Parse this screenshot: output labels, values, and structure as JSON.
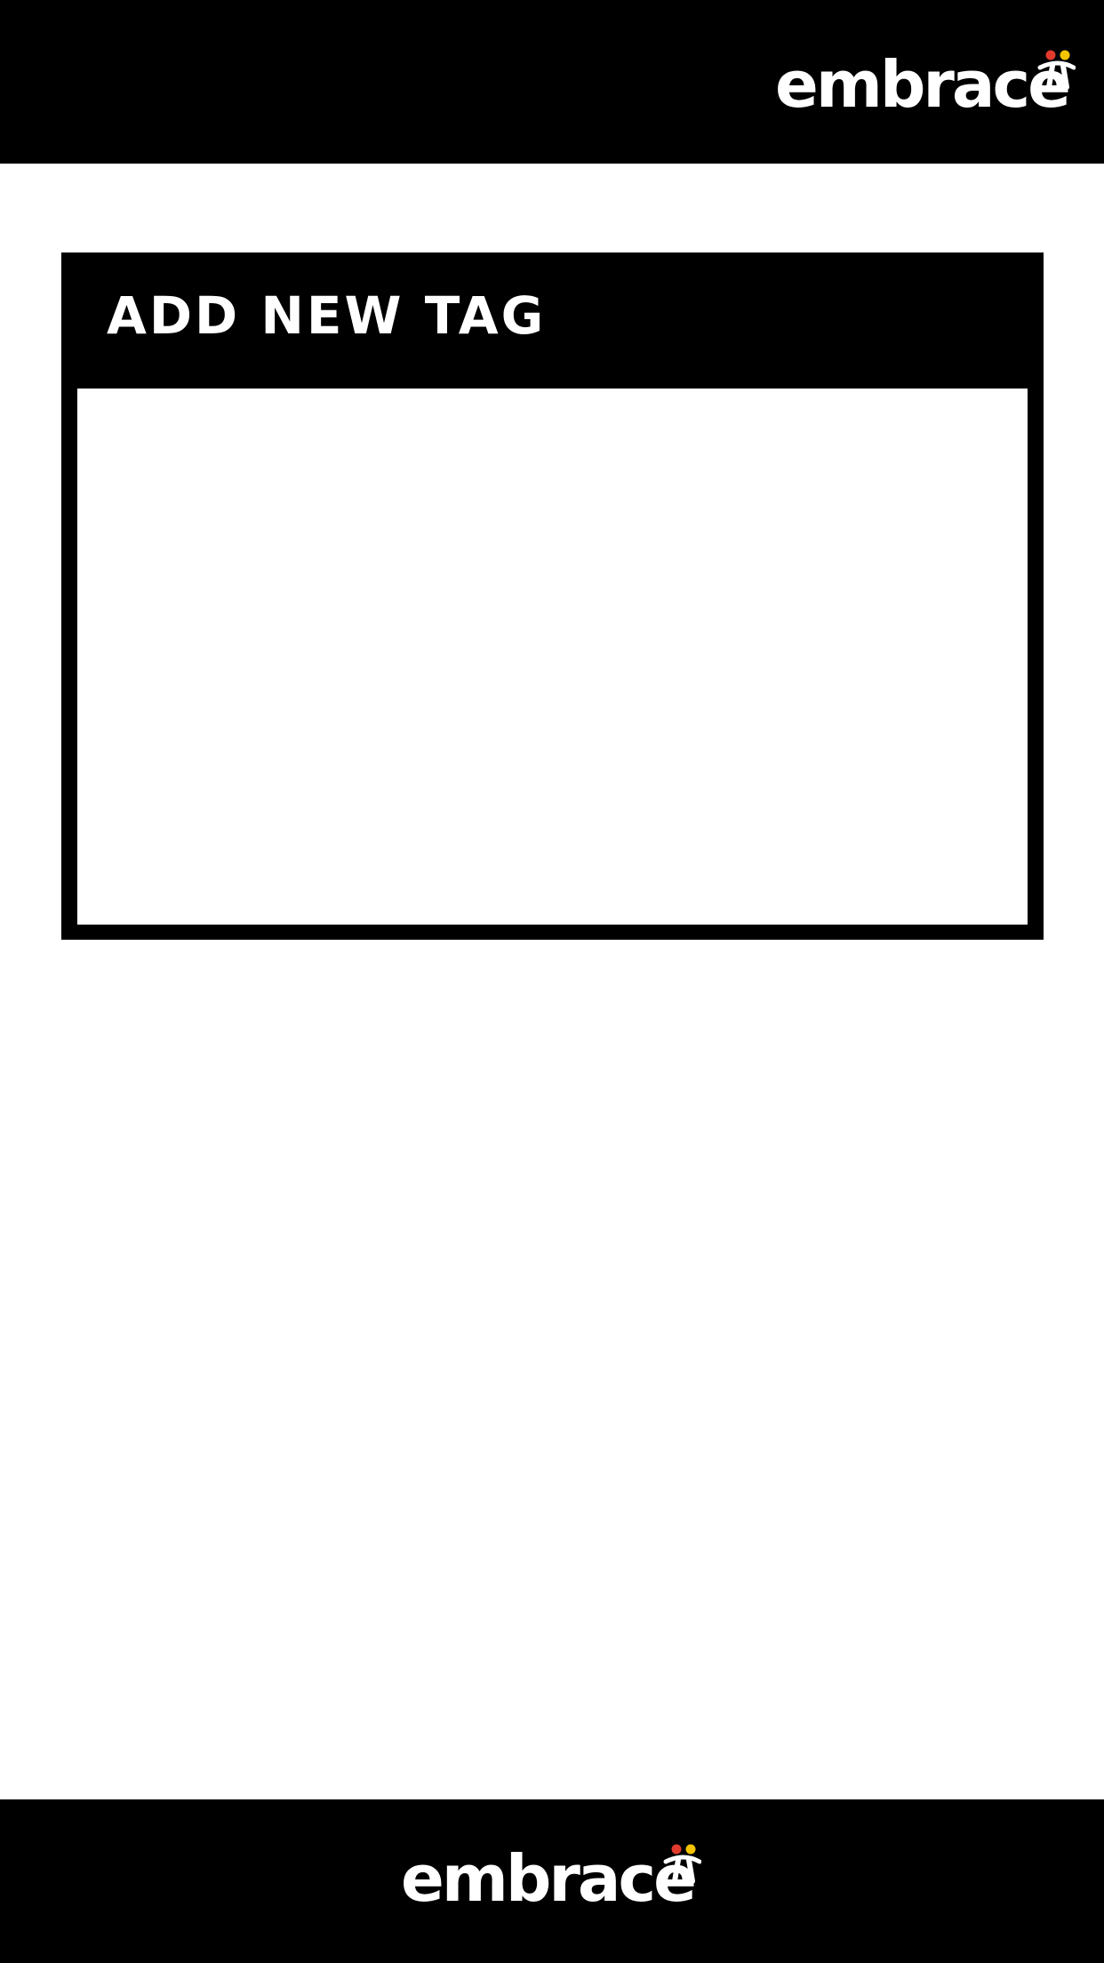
{
  "header": {
    "logo_text": "embrace",
    "logo_icon": "embrace-people-icon"
  },
  "dialog": {
    "title": "ADD NEW TAG"
  },
  "footer": {
    "logo_text": "embrace",
    "logo_icon": "embrace-people-icon"
  },
  "colors": {
    "bar": "#000000",
    "background": "#ffffff",
    "logo_text": "#ffffff",
    "figure_left_head": "#e23b2e",
    "figure_right_head": "#f5c400"
  }
}
